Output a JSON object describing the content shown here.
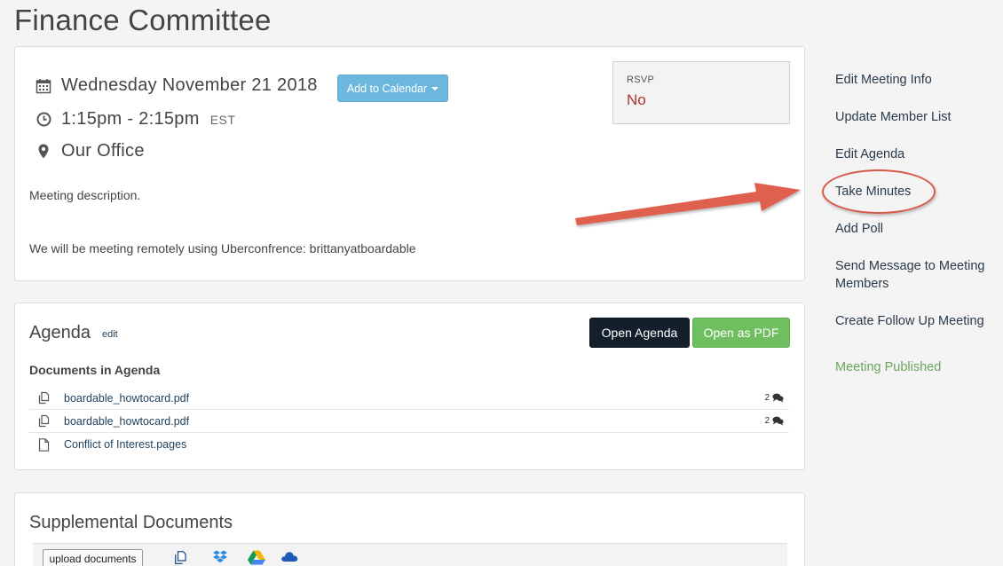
{
  "page": {
    "title": "Finance Committee"
  },
  "meeting": {
    "date": "Wednesday November 21 2018",
    "time": "1:15pm - 2:15pm",
    "timezone": "EST",
    "location": "Our Office",
    "add_to_calendar_label": "Add to Calendar",
    "description_1": "Meeting description.",
    "description_2": "We will be meeting remotely using Uberconfrence: brittanyatboardable",
    "rsvp": {
      "label": "RSVP",
      "value": "No"
    }
  },
  "agenda": {
    "title": "Agenda",
    "edit_label": "edit",
    "open_agenda_label": "Open Agenda",
    "open_pdf_label": "Open as PDF",
    "documents_heading": "Documents in Agenda",
    "documents": [
      {
        "name": "boardable_howtocard.pdf",
        "icon": "copy-icon",
        "comment_count": "2"
      },
      {
        "name": "boardable_howtocard.pdf",
        "icon": "copy-icon",
        "comment_count": "2"
      },
      {
        "name": "Conflict of Interest.pages",
        "icon": "file-icon",
        "comment_count": ""
      }
    ]
  },
  "supplemental": {
    "title": "Supplemental Documents",
    "upload_label": "upload documents",
    "sources": [
      "copy-icon",
      "dropbox-icon",
      "google-drive-icon",
      "onedrive-icon"
    ]
  },
  "sidebar": {
    "links": [
      {
        "label": "Edit Meeting Info"
      },
      {
        "label": "Update Member List"
      },
      {
        "label": "Edit Agenda"
      },
      {
        "label": "Take Minutes"
      },
      {
        "label": "Add Poll"
      },
      {
        "label": "Send Message to Meeting Members"
      },
      {
        "label": "Create Follow Up Meeting"
      }
    ],
    "status": "Meeting Published"
  },
  "colors": {
    "calendar_button": "#6cb7de",
    "open_agenda_button": "#13202c",
    "open_pdf_button": "#6fbe5f",
    "rsvp_no": "#aa3333",
    "published_status": "#6ca55e",
    "annotation": "#d9584a"
  }
}
